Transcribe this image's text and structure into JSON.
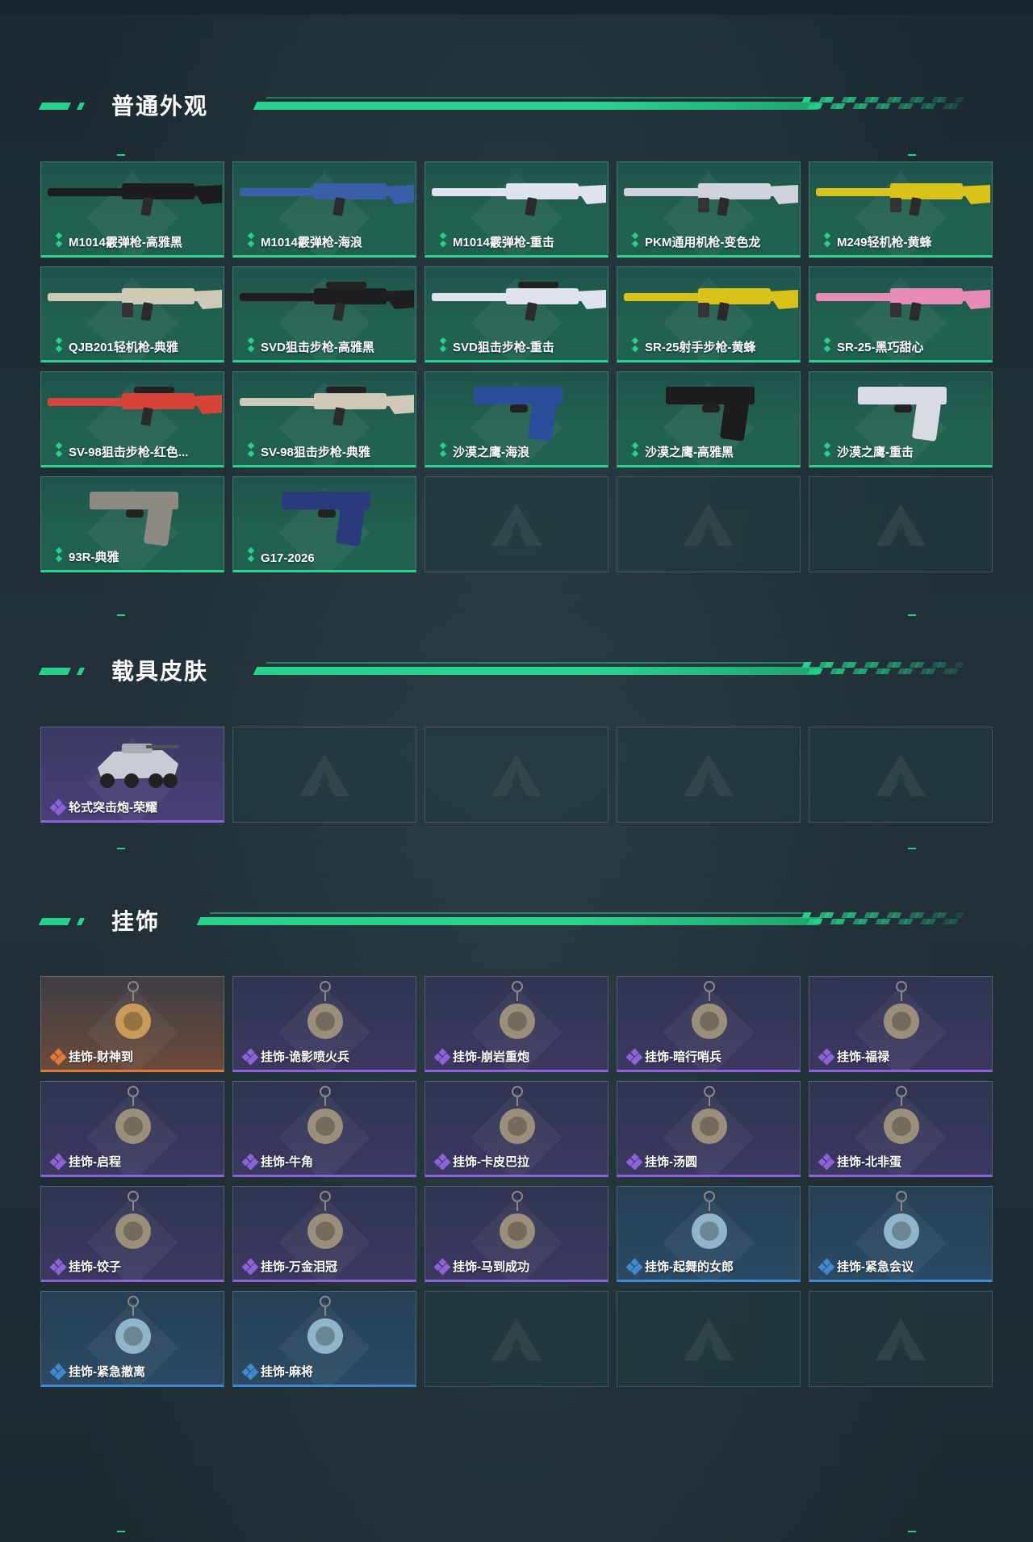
{
  "sections": {
    "weapons": {
      "title": "普通外观",
      "items": [
        {
          "label": "M1014霰弹枪-高雅黑",
          "icon": "shotgun-icon"
        },
        {
          "label": "M1014霰弹枪-海浪",
          "icon": "shotgun-icon"
        },
        {
          "label": "M1014霰弹枪-重击",
          "icon": "shotgun-icon"
        },
        {
          "label": "PKM通用机枪-变色龙",
          "icon": "machine-gun-icon"
        },
        {
          "label": "M249轻机枪-黄蜂",
          "icon": "machine-gun-icon"
        },
        {
          "label": "QJB201轻机枪-典雅",
          "icon": "machine-gun-icon"
        },
        {
          "label": "SVD狙击步枪-高雅黑",
          "icon": "sniper-rifle-icon"
        },
        {
          "label": "SVD狙击步枪-重击",
          "icon": "sniper-rifle-icon"
        },
        {
          "label": "SR-25射手步枪-黄蜂",
          "icon": "rifle-icon"
        },
        {
          "label": "SR-25-黑巧甜心",
          "icon": "rifle-icon"
        },
        {
          "label": "SV-98狙击步枪-红色...",
          "icon": "sniper-rifle-icon"
        },
        {
          "label": "SV-98狙击步枪-典雅",
          "icon": "sniper-rifle-icon"
        },
        {
          "label": "沙漠之鹰-海浪",
          "icon": "pistol-icon"
        },
        {
          "label": "沙漠之鹰-高雅黑",
          "icon": "pistol-icon"
        },
        {
          "label": "沙漠之鹰-重击",
          "icon": "pistol-icon"
        },
        {
          "label": "93R-典雅",
          "icon": "pistol-icon"
        },
        {
          "label": "G17-2026",
          "icon": "pistol-icon"
        }
      ],
      "empty_slots": 3
    },
    "vehicles": {
      "title": "载具皮肤",
      "items": [
        {
          "label": "轮式突击炮-荣耀",
          "icon": "armored-vehicle-icon"
        }
      ],
      "empty_slots": 4
    },
    "charms": {
      "title": "挂饰",
      "items": [
        {
          "label": "挂饰-财神到",
          "rarity": "orange",
          "icon": "charm-icon"
        },
        {
          "label": "挂饰-诡影喷火兵",
          "rarity": "purple",
          "icon": "charm-icon"
        },
        {
          "label": "挂饰-崩岩重炮",
          "rarity": "purple",
          "icon": "charm-icon"
        },
        {
          "label": "挂饰-暗行哨兵",
          "rarity": "purple",
          "icon": "charm-icon"
        },
        {
          "label": "挂饰-福禄",
          "rarity": "purple",
          "icon": "charm-icon"
        },
        {
          "label": "挂饰-启程",
          "rarity": "purple",
          "icon": "charm-icon"
        },
        {
          "label": "挂饰-牛角",
          "rarity": "purple",
          "icon": "charm-icon"
        },
        {
          "label": "挂饰-卡皮巴拉",
          "rarity": "purple",
          "icon": "charm-icon"
        },
        {
          "label": "挂饰-汤圆",
          "rarity": "purple",
          "icon": "charm-icon"
        },
        {
          "label": "挂饰-北非蛋",
          "rarity": "purple",
          "icon": "charm-icon"
        },
        {
          "label": "挂饰-饺子",
          "rarity": "purple",
          "icon": "charm-icon"
        },
        {
          "label": "挂饰-万金泪冠",
          "rarity": "purple",
          "icon": "charm-icon"
        },
        {
          "label": "挂饰-马到成功",
          "rarity": "purple",
          "icon": "charm-icon"
        },
        {
          "label": "挂饰-起舞的女郎",
          "rarity": "blue",
          "icon": "charm-icon"
        },
        {
          "label": "挂饰-紧急会议",
          "rarity": "blue",
          "icon": "charm-icon"
        },
        {
          "label": "挂饰-紧急撤离",
          "rarity": "blue",
          "icon": "charm-icon"
        },
        {
          "label": "挂饰-麻将",
          "rarity": "blue",
          "icon": "charm-icon"
        }
      ],
      "empty_slots": 3
    }
  },
  "colors": {
    "accent_green": "#27d08b",
    "rarity_purple": "#8d63d9",
    "rarity_orange": "#e07a3a",
    "rarity_blue": "#3f8ad0"
  }
}
